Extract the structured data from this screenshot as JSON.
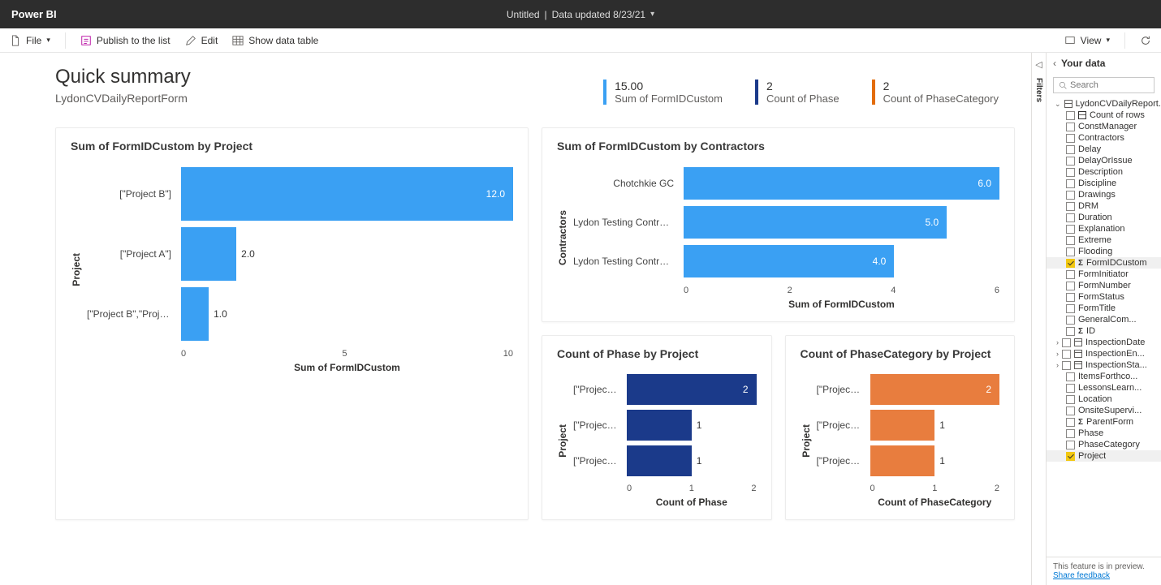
{
  "app_name": "Power BI",
  "title_center": {
    "file": "Untitled",
    "sep": "|",
    "updated": "Data updated 8/23/21"
  },
  "toolbar": {
    "file_label": "File",
    "publish_label": "Publish to the list",
    "edit_label": "Edit",
    "show_table_label": "Show data table",
    "view_label": "View"
  },
  "summary": {
    "title": "Quick summary",
    "subtitle": "LydonCVDailyReportForm",
    "metrics": [
      {
        "value": "15.00",
        "label": "Sum of FormIDCustom",
        "color": "#3aa0f3"
      },
      {
        "value": "2",
        "label": "Count of Phase",
        "color": "#1b3a8a"
      },
      {
        "value": "2",
        "label": "Count of PhaseCategory",
        "color": "#e36c0a"
      }
    ]
  },
  "chart_data": [
    {
      "id": "c1",
      "type": "bar",
      "orientation": "horizontal",
      "color": "#3aa0f3",
      "title": "Sum of FormIDCustom by Project",
      "ylabel": "Project",
      "xlabel": "Sum of FormIDCustom",
      "xlim": [
        0,
        12
      ],
      "ticks": [
        0,
        5,
        10
      ],
      "categories": [
        "[\"Project B\"]",
        "[\"Project A\"]",
        "[\"Project B\",\"Project A\"]"
      ],
      "values": [
        12.0,
        2.0,
        1.0
      ]
    },
    {
      "id": "c2",
      "type": "bar",
      "orientation": "horizontal",
      "color": "#3aa0f3",
      "title": "Sum of FormIDCustom by Contractors",
      "ylabel": "Contractors",
      "xlabel": "Sum of FormIDCustom",
      "xlim": [
        0,
        6
      ],
      "ticks": [
        0,
        2,
        4,
        6
      ],
      "categories": [
        "Chotchkie GC",
        "Lydon Testing Contracto...",
        "Lydon Testing Contracto..."
      ],
      "values": [
        6.0,
        5.0,
        4.0
      ]
    },
    {
      "id": "c3",
      "type": "bar",
      "orientation": "horizontal",
      "color": "#1b3a8a",
      "title": "Count of Phase by Project",
      "ylabel": "Project",
      "xlabel": "Count of Phase",
      "xlim": [
        0,
        2
      ],
      "ticks": [
        0,
        1,
        2
      ],
      "categories": [
        "[\"Project ...",
        "[\"Project ...",
        "[\"Project ..."
      ],
      "values": [
        2,
        1,
        1
      ]
    },
    {
      "id": "c4",
      "type": "bar",
      "orientation": "horizontal",
      "color": "#e87d3e",
      "title": "Count of PhaseCategory by Project",
      "ylabel": "Project",
      "xlabel": "Count of PhaseCategory",
      "xlim": [
        0,
        2
      ],
      "ticks": [
        0,
        1,
        2
      ],
      "categories": [
        "[\"Project ...",
        "[\"Project ...",
        "[\"Project ..."
      ],
      "values": [
        2,
        1,
        1
      ]
    }
  ],
  "filters_label": "Filters",
  "data_pane": {
    "title": "Your data",
    "search_placeholder": "Search",
    "table": "LydonCVDailyReport...",
    "fields": [
      {
        "name": "Count of rows",
        "checked": false,
        "icon": "card"
      },
      {
        "name": "ConstManager",
        "checked": false
      },
      {
        "name": "Contractors",
        "checked": false
      },
      {
        "name": "Delay",
        "checked": false
      },
      {
        "name": "DelayOrIssue",
        "checked": false
      },
      {
        "name": "Description",
        "checked": false
      },
      {
        "name": "Discipline",
        "checked": false
      },
      {
        "name": "Drawings",
        "checked": false
      },
      {
        "name": "DRM",
        "checked": false
      },
      {
        "name": "Duration",
        "checked": false
      },
      {
        "name": "Explanation",
        "checked": false
      },
      {
        "name": "Extreme",
        "checked": false
      },
      {
        "name": "Flooding",
        "checked": false
      },
      {
        "name": "FormIDCustom",
        "checked": true,
        "sigma": true,
        "sel": true
      },
      {
        "name": "FormInitiator",
        "checked": false
      },
      {
        "name": "FormNumber",
        "checked": false
      },
      {
        "name": "FormStatus",
        "checked": false
      },
      {
        "name": "FormTitle",
        "checked": false
      },
      {
        "name": "GeneralCom...",
        "checked": false
      },
      {
        "name": "ID",
        "checked": false,
        "sigma": true
      },
      {
        "name": "InspectionDate",
        "checked": false,
        "expand": true,
        "icon": "calendar"
      },
      {
        "name": "InspectionEn...",
        "checked": false,
        "expand": true,
        "icon": "calendar"
      },
      {
        "name": "InspectionSta...",
        "checked": false,
        "expand": true,
        "icon": "calendar"
      },
      {
        "name": "ItemsForthco...",
        "checked": false
      },
      {
        "name": "LessonsLearn...",
        "checked": false
      },
      {
        "name": "Location",
        "checked": false
      },
      {
        "name": "OnsiteSupervi...",
        "checked": false
      },
      {
        "name": "ParentForm",
        "checked": false,
        "sigma": true
      },
      {
        "name": "Phase",
        "checked": false
      },
      {
        "name": "PhaseCategory",
        "checked": false
      },
      {
        "name": "Project",
        "checked": true,
        "sel": true
      }
    ],
    "footer": {
      "text": "This feature is in preview.",
      "link": "Share feedback"
    }
  }
}
